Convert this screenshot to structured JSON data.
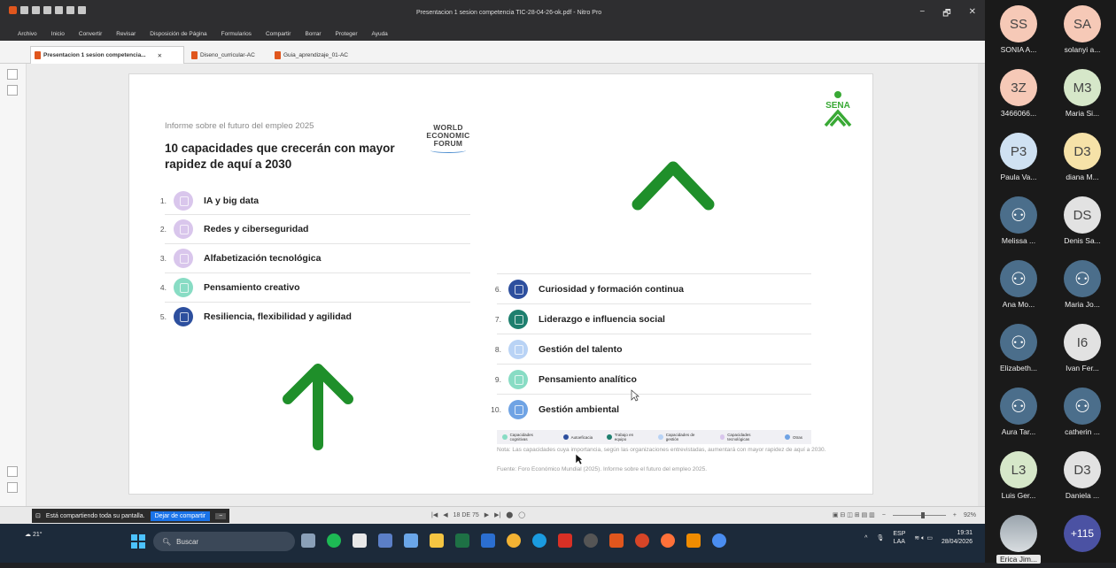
{
  "window": {
    "title": "Presentacion 1 sesion competencia TIC-28-04-26-ok.pdf - Nitro Pro",
    "controls": [
      "−",
      "🗗",
      "✕"
    ]
  },
  "menu": [
    "Archivo",
    "Inicio",
    "Convertir",
    "Revisar",
    "Disposición de Página",
    "Formularios",
    "Compartir",
    "Borrar",
    "Proteger",
    "Ayuda"
  ],
  "tabs": [
    {
      "label": "Presentacion 1 sesion competencia...",
      "close": "✕"
    },
    {
      "label": "Diseno_curricular-AC"
    },
    {
      "label": "Guia_aprendizaje_01-AC"
    }
  ],
  "slide": {
    "subtitle": "Informe sobre el futuro del empleo 2025",
    "title": "10 capacidades que crecerán con mayor rapidez de aquí a 2030",
    "wef_logo": "WORLD ECONOMIC FORUM",
    "sena_logo": "SENA",
    "items": [
      {
        "num": "1.",
        "label": "IA y big data",
        "color": "#d9c6ec"
      },
      {
        "num": "2.",
        "label": "Redes y ciberseguridad",
        "color": "#d9c6ec"
      },
      {
        "num": "3.",
        "label": "Alfabetización tecnológica",
        "color": "#d9c6ec"
      },
      {
        "num": "4.",
        "label": "Pensamiento creativo",
        "color": "#88dcc4"
      },
      {
        "num": "5.",
        "label": "Resiliencia, flexibilidad y agilidad",
        "color": "#2d4f9e"
      },
      {
        "num": "6.",
        "label": "Curiosidad y formación continua",
        "color": "#2d4f9e"
      },
      {
        "num": "7.",
        "label": "Liderazgo e influencia social",
        "color": "#1e7f6e"
      },
      {
        "num": "8.",
        "label": "Gestión del talento",
        "color": "#b9d3f5"
      },
      {
        "num": "9.",
        "label": "Pensamiento analítico",
        "color": "#88dcc4"
      },
      {
        "num": "10.",
        "label": "Gestión ambiental",
        "color": "#6fa3e4"
      }
    ],
    "legend": [
      {
        "label": "Capacidades cognitivas",
        "color": "#88dcc4"
      },
      {
        "label": "Autoeficacia",
        "color": "#2d4f9e"
      },
      {
        "label": "Trabajo en equipo",
        "color": "#1e7f6e"
      },
      {
        "label": "Capacidades de gestión",
        "color": "#b9d3f5"
      },
      {
        "label": "Capacidades tecnológicas",
        "color": "#d9c6ec"
      },
      {
        "label": "Otras",
        "color": "#6fa3e4"
      }
    ],
    "note": "Nota: Las capacidades cuya importancia, según las organizaciones entrevistadas, aumentará con mayor rapidez de aquí a 2030.",
    "source": "Fuente: Foro Económico Mundial (2025). Informe sobre el futuro del empleo 2025."
  },
  "statusbar": {
    "share_text": "Está compartiendo toda su pantalla.",
    "stop_share": "Dejar de compartir",
    "minimize": "−",
    "page_indicator": "18 DE 75",
    "zoom": "92%"
  },
  "taskbar": {
    "weather": "21°",
    "search_placeholder": "Buscar",
    "lang_top": "ESP",
    "lang_bottom": "LAA",
    "time": "19:31",
    "date": "28/04/2026"
  },
  "participants": [
    {
      "initials": "SS",
      "name": "SONIA A...",
      "style": "peach"
    },
    {
      "initials": "SA",
      "name": "solanyi a...",
      "style": "peach"
    },
    {
      "initials": "3Z",
      "name": "3466066...",
      "style": "peach"
    },
    {
      "initials": "M3",
      "name": "Maria Si...",
      "style": "grn"
    },
    {
      "initials": "P3",
      "name": "Paula Va...",
      "style": "blue"
    },
    {
      "initials": "D3",
      "name": "diana M...",
      "style": "yel"
    },
    {
      "initials": "",
      "name": "Melissa ...",
      "style": "anon"
    },
    {
      "initials": "DS",
      "name": "Denis Sa...",
      "style": "gray"
    },
    {
      "initials": "",
      "name": "Ana Mo...",
      "style": "anon"
    },
    {
      "initials": "",
      "name": "Maria Jo...",
      "style": "anon"
    },
    {
      "initials": "",
      "name": "Elizabeth...",
      "style": "anon"
    },
    {
      "initials": "I6",
      "name": "Ivan Fer...",
      "style": "gray"
    },
    {
      "initials": "",
      "name": "Aura Tar...",
      "style": "anon"
    },
    {
      "initials": "",
      "name": "catherin ...",
      "style": "anon"
    },
    {
      "initials": "L3",
      "name": "Luis Ger...",
      "style": "grn"
    },
    {
      "initials": "D3",
      "name": "Daniela ...",
      "style": "gray"
    },
    {
      "initials": "",
      "name": "Erica Jim...",
      "style": "photo"
    },
    {
      "initials": "+115",
      "name": "",
      "style": "more"
    }
  ]
}
